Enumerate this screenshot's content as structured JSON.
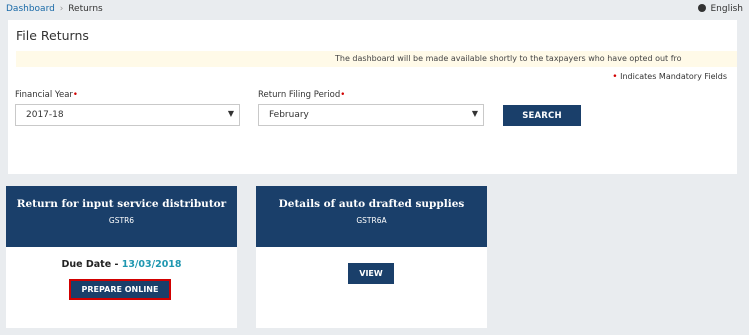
{
  "breadcrumb": {
    "home": "Dashboard",
    "separator": "›",
    "current": "Returns"
  },
  "language": {
    "icon": "globe-icon",
    "label": "English"
  },
  "file_returns": {
    "title": "File Returns",
    "notice": "The dashboard will be made available shortly to the taxpayers who have opted out fro",
    "mandatory_note": "Indicates Mandatory Fields",
    "financial_year": {
      "label": "Financial Year",
      "required_mark": "•",
      "value": "2017-18"
    },
    "return_period": {
      "label": "Return Filing Period",
      "required_mark": "•",
      "value": "February"
    },
    "search_label": "SEARCH"
  },
  "cards": [
    {
      "title": "Return for input service distributor",
      "subtitle": "GSTR6",
      "due_label": "Due Date -",
      "due_date": "13/03/2018",
      "button_label": "PREPARE ONLINE"
    },
    {
      "title": "Details of auto drafted supplies",
      "subtitle": "GSTR6A",
      "button_label": "VIEW"
    }
  ],
  "colors": {
    "navy": "#1a3f6a",
    "link": "#1a6aa8",
    "due_date": "#1f97b0",
    "required": "#d10000"
  }
}
